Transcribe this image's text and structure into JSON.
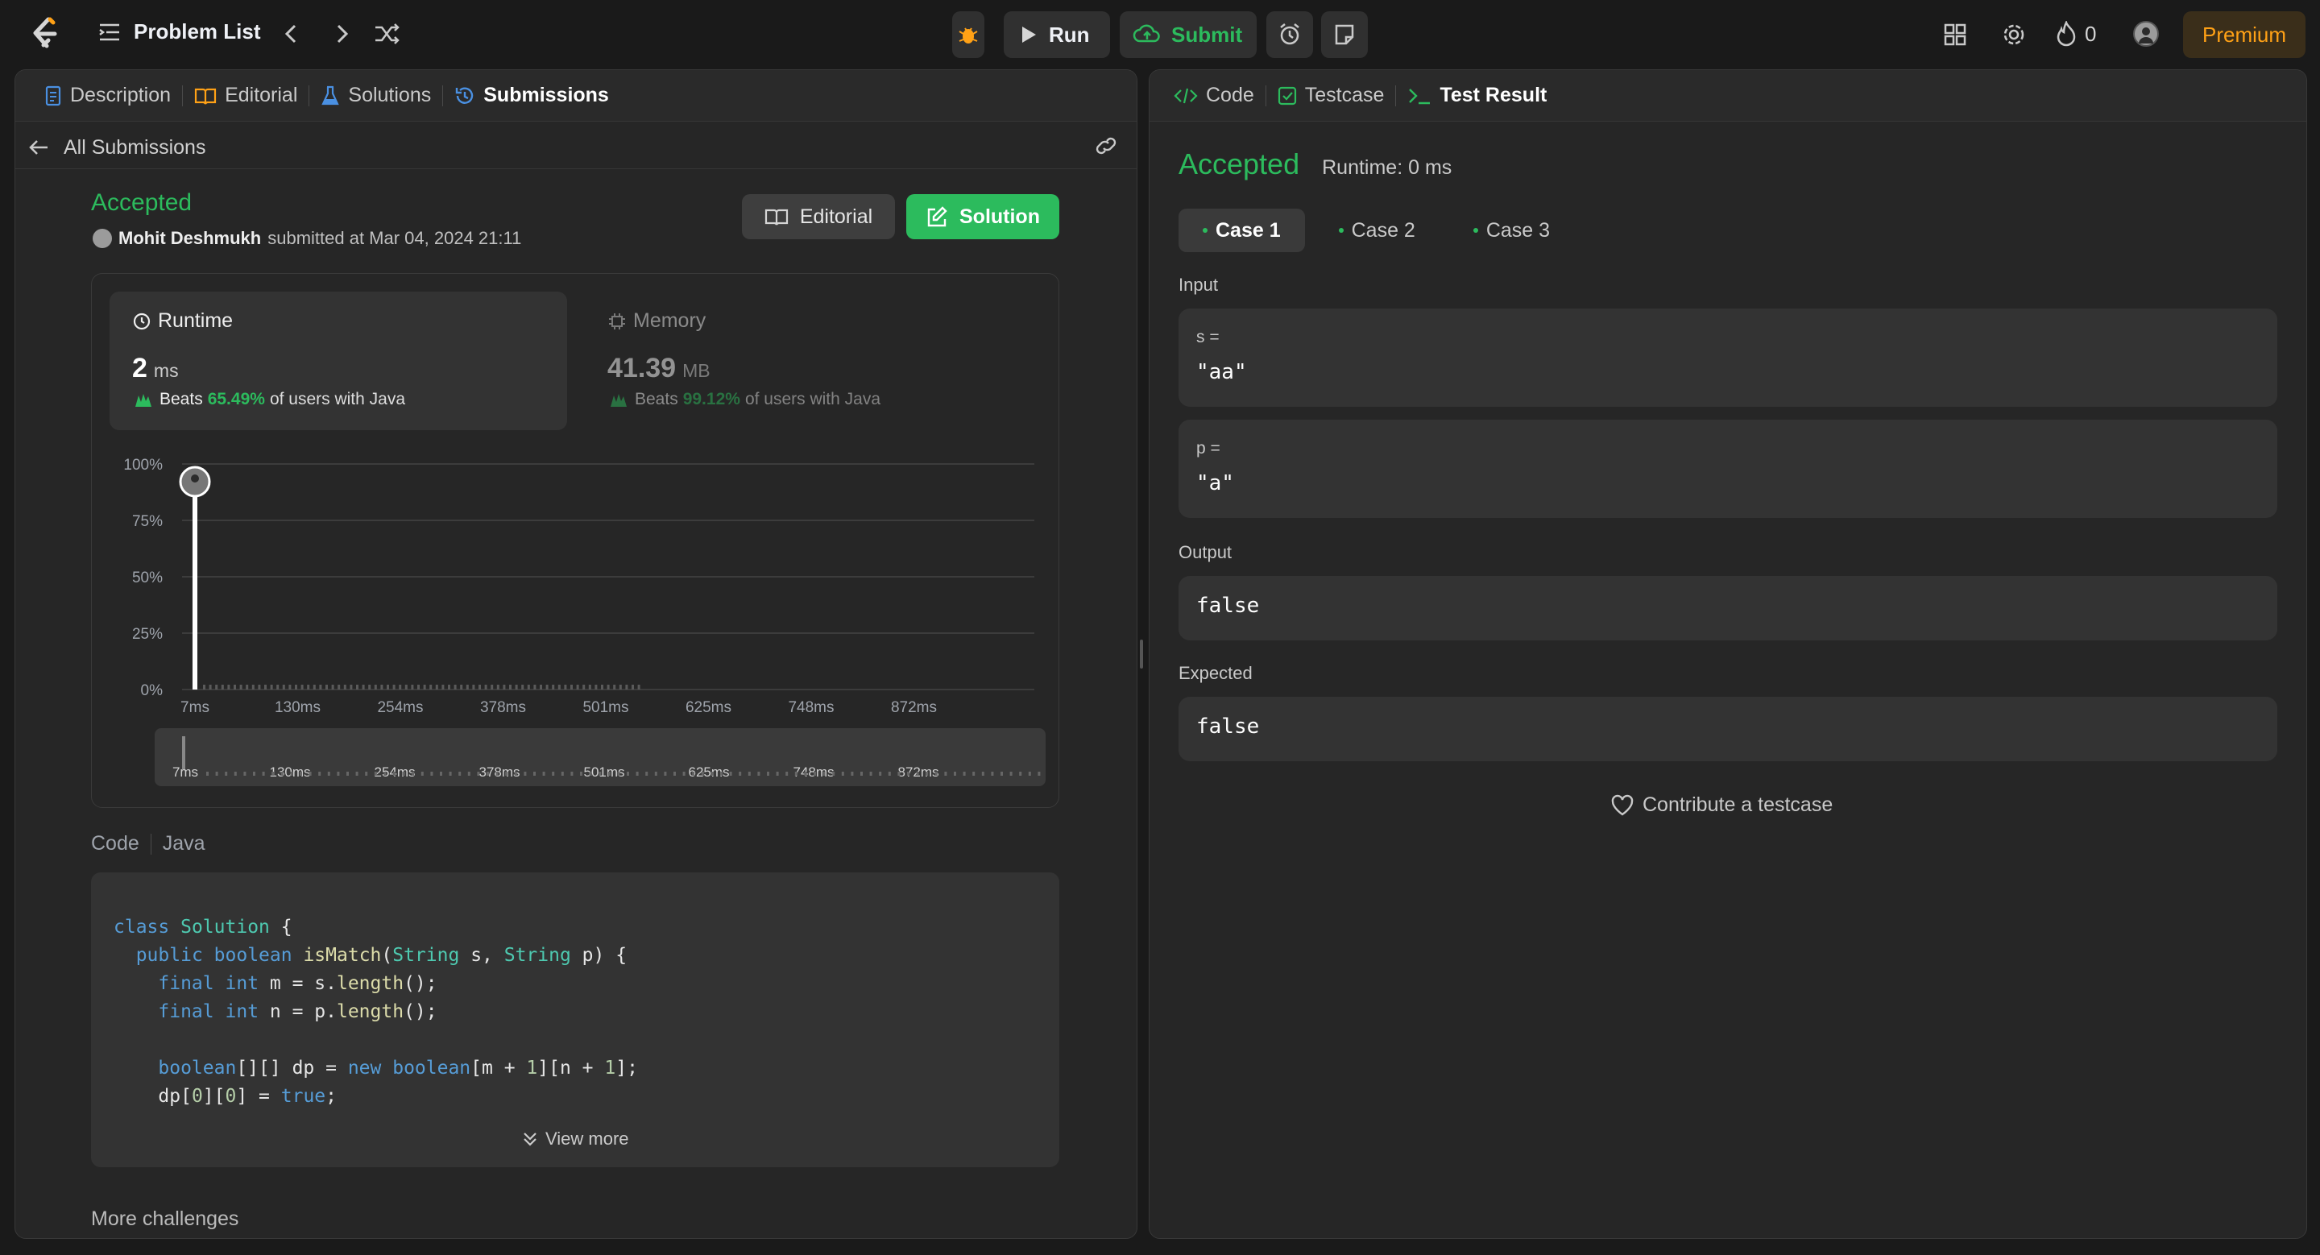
{
  "header": {
    "problem_list": "Problem List",
    "run": "Run",
    "submit": "Submit",
    "streak": "0",
    "premium": "Premium"
  },
  "left_tabs": [
    {
      "label": "Description"
    },
    {
      "label": "Editorial"
    },
    {
      "label": "Solutions"
    },
    {
      "label": "Submissions"
    }
  ],
  "submission": {
    "back_label": "All Submissions",
    "status": "Accepted",
    "user": "Mohit Deshmukh",
    "submitted_at": "submitted at Mar 04, 2024 21:11",
    "editorial_btn": "Editorial",
    "solution_btn": "Solution",
    "runtime": {
      "title": "Runtime",
      "value": "2",
      "unit": "ms",
      "beats": "Beats",
      "pct": "65.49%",
      "suffix": "of users with Java"
    },
    "memory": {
      "title": "Memory",
      "value": "41.39",
      "unit": "MB",
      "beats": "Beats",
      "pct": "99.12%",
      "suffix": "of users with Java"
    },
    "code_label": "Code",
    "lang": "Java",
    "view_more": "View more",
    "more_challenges": "More challenges"
  },
  "chart_data": {
    "type": "bar",
    "y_ticks": [
      "100%",
      "75%",
      "50%",
      "25%",
      "0%"
    ],
    "x_ticks": [
      "7ms",
      "130ms",
      "254ms",
      "378ms",
      "501ms",
      "625ms",
      "748ms",
      "872ms"
    ],
    "ylim": [
      0,
      100
    ],
    "highlight": {
      "x": "7ms",
      "value": 100
    },
    "grid": true
  },
  "right_tabs": [
    {
      "label": "Code"
    },
    {
      "label": "Testcase"
    },
    {
      "label": "Test Result"
    }
  ],
  "result": {
    "status": "Accepted",
    "runtime": "Runtime: 0 ms",
    "cases": [
      "Case 1",
      "Case 2",
      "Case 3"
    ],
    "input_label": "Input",
    "s_name": "s =",
    "s_value": "\"aa\"",
    "p_name": "p =",
    "p_value": "\"a\"",
    "output_label": "Output",
    "output_value": "false",
    "expected_label": "Expected",
    "expected_value": "false",
    "contribute": "Contribute a testcase"
  },
  "colors": {
    "accent_green": "#2cbb5d",
    "premium": "#ffa116",
    "link_blue": "#4a90e2"
  }
}
